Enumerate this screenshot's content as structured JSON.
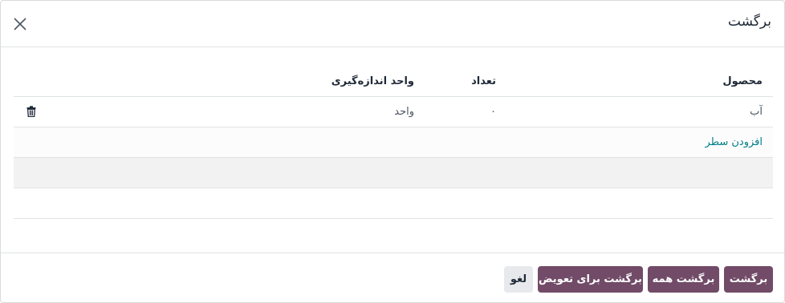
{
  "dialog": {
    "title": "برگشت",
    "close_icon": "close-icon"
  },
  "table": {
    "headers": {
      "product": "محصول",
      "quantity": "تعداد",
      "uom": "واحد اندازه‌گیری"
    },
    "rows": [
      {
        "product": "آب",
        "quantity": "۰",
        "uom": "واحد",
        "delete_icon": "trash-icon"
      }
    ],
    "add_line": "افزودن سطر"
  },
  "footer": {
    "return_label": "برگشت",
    "return_all_label": "برگشت همه",
    "return_exchange_label": "برگشت برای تعویض",
    "cancel_label": "لغو"
  },
  "colors": {
    "primary": "#714b67",
    "link": "#017e84"
  }
}
